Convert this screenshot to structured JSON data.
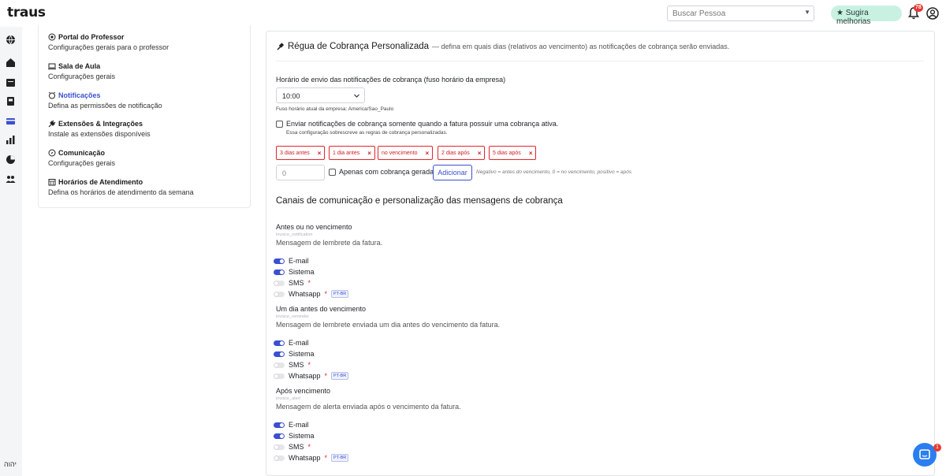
{
  "header": {
    "logo": "traus",
    "search_placeholder": "Buscar Pessoa",
    "suggest_label": "Sugira melhorias",
    "notifications_count": "78"
  },
  "rail": {
    "bottom_text": "יהוה"
  },
  "nav": {
    "items": [
      {
        "title": "Portal do Professor",
        "desc": "Configurações gerais para o professor"
      },
      {
        "title": "Sala de Aula",
        "desc": "Configurações gerais"
      },
      {
        "title": "Notificações",
        "desc": "Defina as permissões de notificação"
      },
      {
        "title": "Extensões & Integrações",
        "desc": "Instale as extensões disponíveis"
      },
      {
        "title": "Comunicação",
        "desc": "Configurações gerais"
      },
      {
        "title": "Horários de Atendimento",
        "desc": "Defina os horários de atendimento da semana"
      }
    ]
  },
  "main": {
    "title": "Régua de Cobrança Personalizada",
    "subtitle": "— defina em quais dias (relativos ao vencimento) as notificações de cobrança serão enviadas.",
    "send_time_label": "Horário de envio das notificações de cobrança (fuso horário da empresa)",
    "send_time_value": "10:00",
    "timezone_note": "Fuso horário atual da empresa: America/Sao_Paulo",
    "active_only_label": "Enviar notificações de cobrança somente quando a fatura possuir uma cobrança ativa.",
    "active_only_note": "Essa configuração sobrescreve as regras de cobrança personalizadas.",
    "chips": [
      "3 dias antes",
      "1 dia antes",
      "no vencimento",
      "2 dias após",
      "5 dias após"
    ],
    "chip_remove": "×",
    "day_input_placeholder": "0",
    "only_generated_label": "Apenas com cobrança gerada",
    "add_button": "Adicionar",
    "hint": "Negativo = antes do vencimento, 0 = no vencimento, positivo = após",
    "channels_heading": "Canais de comunicação e personalização das mensagens de cobrança",
    "groups": [
      {
        "title": "Antes ou no vencimento",
        "key": "invoice_notification",
        "desc": "Mensagem de lembrete da fatura.",
        "channels": [
          {
            "label": "E-mail",
            "on": true
          },
          {
            "label": "Sistema",
            "on": true
          },
          {
            "label": "SMS",
            "on": false
          },
          {
            "label": "Whatsapp",
            "on": false
          }
        ]
      },
      {
        "title": "Um dia antes do vencimento",
        "key": "invoice_reminder",
        "desc": "Mensagem de lembrete enviada um dia antes do vencimento da fatura.",
        "channels": [
          {
            "label": "E-mail",
            "on": true
          },
          {
            "label": "Sistema",
            "on": true
          },
          {
            "label": "SMS",
            "on": false
          },
          {
            "label": "Whatsapp",
            "on": false
          }
        ]
      },
      {
        "title": "Após vencimento",
        "key": "invoice_alert",
        "desc": "Mensagem de alerta enviada após o vencimento da fatura.",
        "channels": [
          {
            "label": "E-mail",
            "on": true
          },
          {
            "label": "Sistema",
            "on": true
          },
          {
            "label": "SMS",
            "on": false
          },
          {
            "label": "Whatsapp",
            "on": false
          }
        ]
      }
    ],
    "required_mark": "*",
    "lang_badge": "PT-BR"
  },
  "chat": {
    "badge": "1"
  },
  "colors": {
    "accent": "#3b4fd0",
    "danger": "#e0262c",
    "suggest_bg": "#c9f1e2",
    "chat": "#2a7ef0"
  }
}
